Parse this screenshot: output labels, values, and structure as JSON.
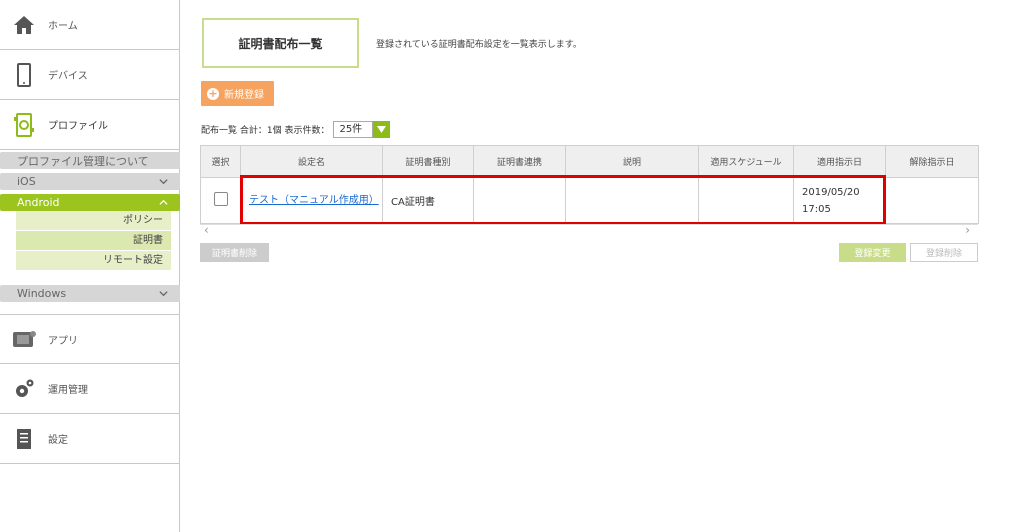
{
  "sidebar": {
    "home": "ホーム",
    "device": "デバイス",
    "profile": "プロファイル",
    "profile_about": "プロファイル管理について",
    "ios": "iOS",
    "android": "Android",
    "android_items": [
      "ポリシー",
      "証明書",
      "リモート設定"
    ],
    "windows": "Windows",
    "app": "アプリ",
    "operation": "運用管理",
    "settings": "設定"
  },
  "page": {
    "title": "証明書配布一覧",
    "description": "登録されている証明書配布設定を一覧表示します。",
    "new_button": "新規登録"
  },
  "summary": {
    "label": "配布一覧 合計：1個 表示件数：",
    "page_size": "25件"
  },
  "table": {
    "headers": [
      "選択",
      "設定名",
      "証明書種別",
      "証明書連携",
      "説明",
      "適用スケジュール",
      "適用指示日",
      "解除指示日"
    ],
    "rows": [
      {
        "name": "テスト（マニュアル作成用）",
        "cert_type": "CA証明書",
        "cert_link": "",
        "description": "",
        "schedule": "",
        "apply_date": "2019/05/20 17:05",
        "release_date": ""
      }
    ]
  },
  "buttons": {
    "delete_cert": "証明書削除",
    "edit": "登録変更",
    "remove": "登録削除"
  },
  "colors": {
    "accent_green": "#9cc41f",
    "orange": "#f7a360",
    "highlight_red": "#e00000",
    "link": "#1a6bd1"
  }
}
